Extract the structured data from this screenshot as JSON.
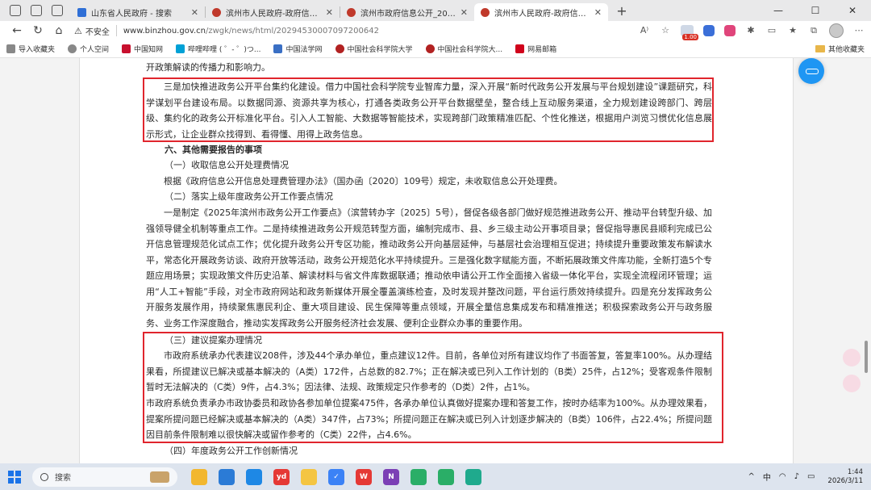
{
  "browser": {
    "tabs": [
      {
        "title": "山东省人民政府 - 搜索",
        "favicon": "search-favicon",
        "active": false
      },
      {
        "title": "滨州市人民政府-政府信息公开-政",
        "favicon": "gov-favicon",
        "active": false
      },
      {
        "title": "滨州市政府信息公开_2025年政府",
        "favicon": "gov-favicon",
        "active": false
      },
      {
        "title": "滨州市人民政府-政府信息公开-政",
        "favicon": "gov-favicon",
        "active": true
      }
    ],
    "new_tab": "+",
    "window_controls": {
      "minimize": "—",
      "maximize": "☐",
      "close": "✕"
    },
    "address": {
      "security": "不安全",
      "host": "www.binzhou.gov.cn",
      "path": "/zwgk/news/html/2029453000709720064​2"
    },
    "extension_badge": "1.00",
    "bookmarks": [
      {
        "label": "导入收藏夹",
        "icon": "import-icon",
        "color": "#555555"
      },
      {
        "label": "个人空间",
        "icon": "person-icon",
        "color": "#555555"
      },
      {
        "label": "中国知网",
        "icon": "cnki-icon",
        "color": "#c8102e"
      },
      {
        "label": "哔哩哔哩 ( ゜- ゜)つ...",
        "icon": "bilibili-icon",
        "color": "#00a1d6"
      },
      {
        "label": "中国法学网",
        "icon": "law-icon",
        "color": "#3a6fc4"
      },
      {
        "label": "中国社会科学院大学",
        "icon": "cass-icon",
        "color": "#b22222"
      },
      {
        "label": "中国社会科学院大...",
        "icon": "cass-icon",
        "color": "#b22222"
      },
      {
        "label": "网易邮箱",
        "icon": "mail-icon",
        "color": "#d0021b"
      }
    ],
    "other_bookmarks": "其他收藏夹"
  },
  "article": {
    "line_top": "开政策解读的传播力和影响力。",
    "para_3": "三是加快推进政务公开平台集约化建设。借力中国社会科学院专业智库力量，深入开展“新时代政务公开发展与平台规划建设”课题研究，科学谋划平台建设布局。以数据同源、资源共享为核心，打通各类政务公开平台数据壁垒，整合线上互动服务渠道，全力规划建设跨部门、跨层级、集约化的政务公开标准化平台。引入人工智能、大数据等智能技术，实现跨部门政策精准匹配、个性化推送，根据用户浏览习惯优化信息展示形式，让企业群众找得到、看得懂、用得上政务信息。",
    "heading_6": "六、其他需要报告的事项",
    "sub_1": "（一）收取信息公开处理费情况",
    "para_fee": "根据《政府信息公开信息处理费管理办法》（国办函〔2020〕109号）规定，未收取信息公开处理费。",
    "sub_2": "（二）落实上级年度政务公开工作要点情况",
    "para_points": "一是制定《2025年滨州市政务公开工作要点》（滨营转办字〔2025〕5号），督促各级各部门做好规范推进政务公开、推动平台转型升级、加强领导健全机制等重点工作。二是持续推进政务公开规范转型方面，编制完成市、县、乡三级主动公开事项目录；督促指导惠民县顺利完成已公开信息管理规范化试点工作；优化提升政务公开专区功能，推动政务公开向基层延伸，与基层社会治理相互促进；持续提升重要政策发布解读水平，常态化开展政务访谈、政府开放等活动，政务公开规范化水平持续提升。三是强化数字赋能方面，不断拓展政策文件库功能，全新打造5个专题应用场景；实现政策文件历史沿革、解读材料与省文件库数据联通；推动依申请公开工作全面接入省级一体化平台，实现全流程闭环管理；运用“人工+智能”手段，对全市政府网站和政务新媒体开展全覆盖演练检查，及时发现并整改问题，平台运行质效持续提升。四是充分发挥政务公开服务发展作用，持续聚焦惠民利企、重大项目建设、民生保障等重点领域，开展全量信息集成发布和精准推送；积极探索政务公开与政务服务、业务工作深度融合，推动实发挥政务公开服务经济社会发展、便利企业群众办事的重要作用。",
    "sub_3": "（三）建议提案办理情况",
    "para_proposal_1": "市政府系统承办代表建议208件，涉及44个承办单位，重点建议12件。目前，各单位对所有建议均作了书面答复，答复率100%。从办理结果看，所提建议已解决或基本解决的（A类）172件，占总数的82.7%；正在解决或已列入工作计划的（B类）25件，占12%；受客观条件限制暂时无法解决的（C类）9件，占4.3%；因法律、法规、政策规定只作参考的（D类）2件，占1%。",
    "para_proposal_2": "市政府系统负责承办市政协委员和政协各参加单位提案475件，各承办单位认真做好提案办理和答复工作，按时办结率为100%。从办理效果看，提案所提问题已经解决或基本解决的（A类）347件，占73%；所提问题正在解决或已列入计划逐步解决的（B类）106件，占22.4%；所提问题因目前条件限制难以很快解决或留作参考的（C类）22件，占4.6%。",
    "sub_4": "（四）年度政务公开工作创新情况"
  },
  "highlight_color": "#e0252d",
  "taskbar": {
    "search_placeholder": "搜索",
    "apps": [
      {
        "name": "file-explorer-icon",
        "color": "#f2b72f",
        "label": ""
      },
      {
        "name": "store-icon",
        "color": "#2b7bd6",
        "label": ""
      },
      {
        "name": "edge-icon",
        "color": "#1e88e5",
        "label": ""
      },
      {
        "name": "youdao-icon",
        "color": "#e53935",
        "label": "yd"
      },
      {
        "name": "folder-icon",
        "color": "#f4c542",
        "label": ""
      },
      {
        "name": "todo-icon",
        "color": "#3b82f6",
        "label": "✓"
      },
      {
        "name": "wps-icon",
        "color": "#e53935",
        "label": "W"
      },
      {
        "name": "onenote-icon",
        "color": "#7b3fb5",
        "label": "N"
      },
      {
        "name": "wechat-icon",
        "color": "#2aae67",
        "label": ""
      },
      {
        "name": "app-icon",
        "color": "#2aae67",
        "label": ""
      },
      {
        "name": "screen-icon",
        "color": "#1faa8d",
        "label": ""
      }
    ],
    "tray": {
      "chevron": "^",
      "ime": "中",
      "time": "1:44",
      "date": "2026/3/11"
    }
  }
}
